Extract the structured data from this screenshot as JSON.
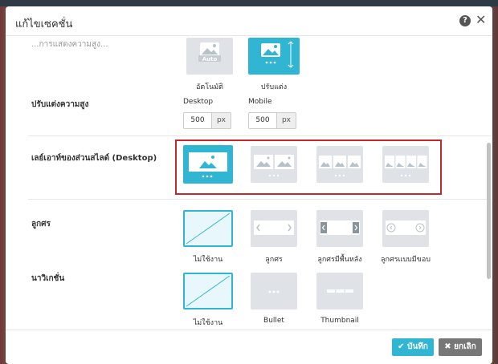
{
  "modal": {
    "title": "แก้ไขเซคชั่น",
    "help_icon": "?",
    "close_icon": "✕"
  },
  "section_height_mode": {
    "label_partial": "...การแสดงความสูง...",
    "options": [
      {
        "caption": "อัตโนมัติ",
        "badge": "Auto",
        "selected": false
      },
      {
        "caption": "ปรับแต่ง",
        "selected": true
      }
    ]
  },
  "custom_height": {
    "label": "ปรับแต่งความสูง",
    "desktop": {
      "label": "Desktop",
      "value": "500",
      "unit": "px"
    },
    "mobile": {
      "label": "Mobile",
      "value": "500",
      "unit": "px"
    }
  },
  "slide_layout": {
    "label": "เลย์เอาท์ของส่วนสไลด์ (Desktop)",
    "options": [
      {
        "name": "1-per-slide",
        "selected": true
      },
      {
        "name": "2-per-slide",
        "selected": false
      },
      {
        "name": "3-per-slide",
        "selected": false
      },
      {
        "name": "4-per-slide",
        "selected": false
      }
    ]
  },
  "arrows": {
    "label": "ลูกศร",
    "options": [
      {
        "caption": "ไม่ใช้งาน",
        "selected": true
      },
      {
        "caption": "ลูกศร",
        "selected": false
      },
      {
        "caption": "ลูกศรมีพื้นหลัง",
        "selected": false
      },
      {
        "caption": "ลูกศรแบบมีขอบ",
        "selected": false
      }
    ]
  },
  "navigation": {
    "label": "นาวิเกชั่น",
    "options": [
      {
        "caption": "ไม่ใช้งาน",
        "selected": true
      },
      {
        "caption": "Bullet",
        "selected": false
      },
      {
        "caption": "Thumbnail",
        "selected": false
      }
    ]
  },
  "footer": {
    "save_label": "บันทึก",
    "cancel_label": "ยกเลิก",
    "save_icon": "✔",
    "cancel_icon": "✖"
  },
  "colors": {
    "accent": "#30b6d3",
    "highlight_border": "#c4262e",
    "option_bg": "#dfe3e7",
    "cancel_bg": "#777777"
  }
}
